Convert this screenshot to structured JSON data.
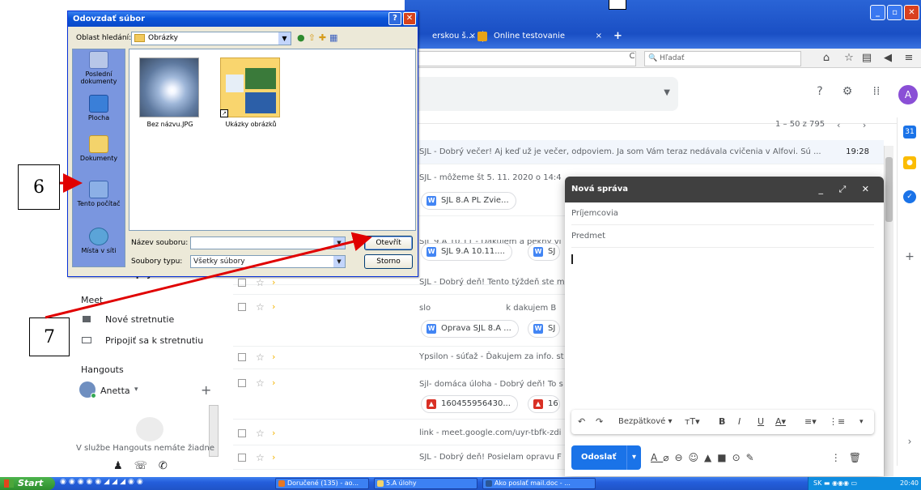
{
  "browser": {
    "tabs": [
      {
        "label": "erskou š...",
        "close": "×"
      },
      {
        "label": "Online testovanie",
        "close": "×"
      }
    ],
    "new_tab": "+",
    "search_placeholder": "Hľadať",
    "window_controls": [
      "_",
      "▫",
      "✕"
    ]
  },
  "gmail": {
    "pager": "1 – 50 z 795",
    "avatar": "A",
    "rows": [
      {
        "subject": "SJL",
        "text": "SJL - Dobrý večer! Aj keď už je večer, odpoviem. Ja som Vám teraz nedávala cvičenia v Alfovi. Sú ...",
        "time": "19:28"
      },
      {
        "subject": "SJL",
        "text": "SJL - môžeme št 5. 11. 2020 o 14:4",
        "time": ""
      },
      {
        "subject": "SJL 9.A",
        "text": "SJL 9.A 10.11 - Ďakujem a pekný vi",
        "time": ""
      },
      {
        "subject": "SJL",
        "text": "SJL - Dobrý deň! Tento týždeň ste m",
        "time": ""
      },
      {
        "subject": "slo",
        "text": "slo          k dakujem B",
        "time": ""
      },
      {
        "subject": "Ypsilon",
        "text": "Ypsilon - súťaž - Ďakujem za info. st",
        "time": ""
      },
      {
        "subject": "Sjl",
        "text": "Sjl- domáca úloha - Dobrý deň! To s",
        "time": ""
      },
      {
        "subject": "link",
        "text": "link - meet.google.com/uyr-tbfk-zdi",
        "time": ""
      },
      {
        "subject": "SJL",
        "text": "SJL - Dobrý deň! Posielam opravu F",
        "time": ""
      }
    ],
    "chips": [
      {
        "label": "SJL 8.A PL Zvie...",
        "type": "W"
      },
      {
        "label": "SJL 9.A 10.11....",
        "type": "W"
      },
      {
        "label": "SJ",
        "type": "W"
      },
      {
        "label": "Oprava SJL 8.A ...",
        "type": "W"
      },
      {
        "label": "SJ",
        "type": "W"
      },
      {
        "label": "160455956430...",
        "type": "img"
      },
      {
        "label": "16",
        "type": "img"
      }
    ],
    "sidebar": {
      "drafts": "Koncepty",
      "meet_header": "Meet",
      "new_meeting": "Nové stretnutie",
      "join_meeting": "Pripojiť sa k stretnutiu",
      "hangouts_header": "Hangouts",
      "user": "Anetta",
      "hangouts_empty": "V službe Hangouts nemáte žiadne"
    }
  },
  "compose": {
    "title": "Nová správa",
    "recipients": "Príjemcovia",
    "subject": "Predmet",
    "font": "Bezpätkové",
    "send": "Odoslať"
  },
  "dialog": {
    "title": "Odovzdať súbor",
    "look_in_label": "Oblast hledání:",
    "look_in_value": "Obrázky",
    "places": [
      "Poslední dokumenty",
      "Plocha",
      "Dokumenty",
      "Tento počítač",
      "Místa v síti"
    ],
    "files": [
      "Bez názvu.JPG",
      "Ukázky obrázků"
    ],
    "filename_label": "Název souboru:",
    "filetype_label": "Soubory typu:",
    "filetype_value": "Všetky súbory",
    "open_button": "Otevřít",
    "cancel_button": "Storno"
  },
  "annotations": [
    "6",
    "7"
  ],
  "taskbar": {
    "start": "Start",
    "items": [
      "Doručené (135) - ao...",
      "5.A úlohy",
      "Ako poslať mail.doc - ..."
    ],
    "tray_lang": "SK",
    "clock": "20:40"
  },
  "colors": {
    "accent": "#1a73e8",
    "annotation_arrow": "#e00000",
    "xp_title": "#0a55d9"
  }
}
